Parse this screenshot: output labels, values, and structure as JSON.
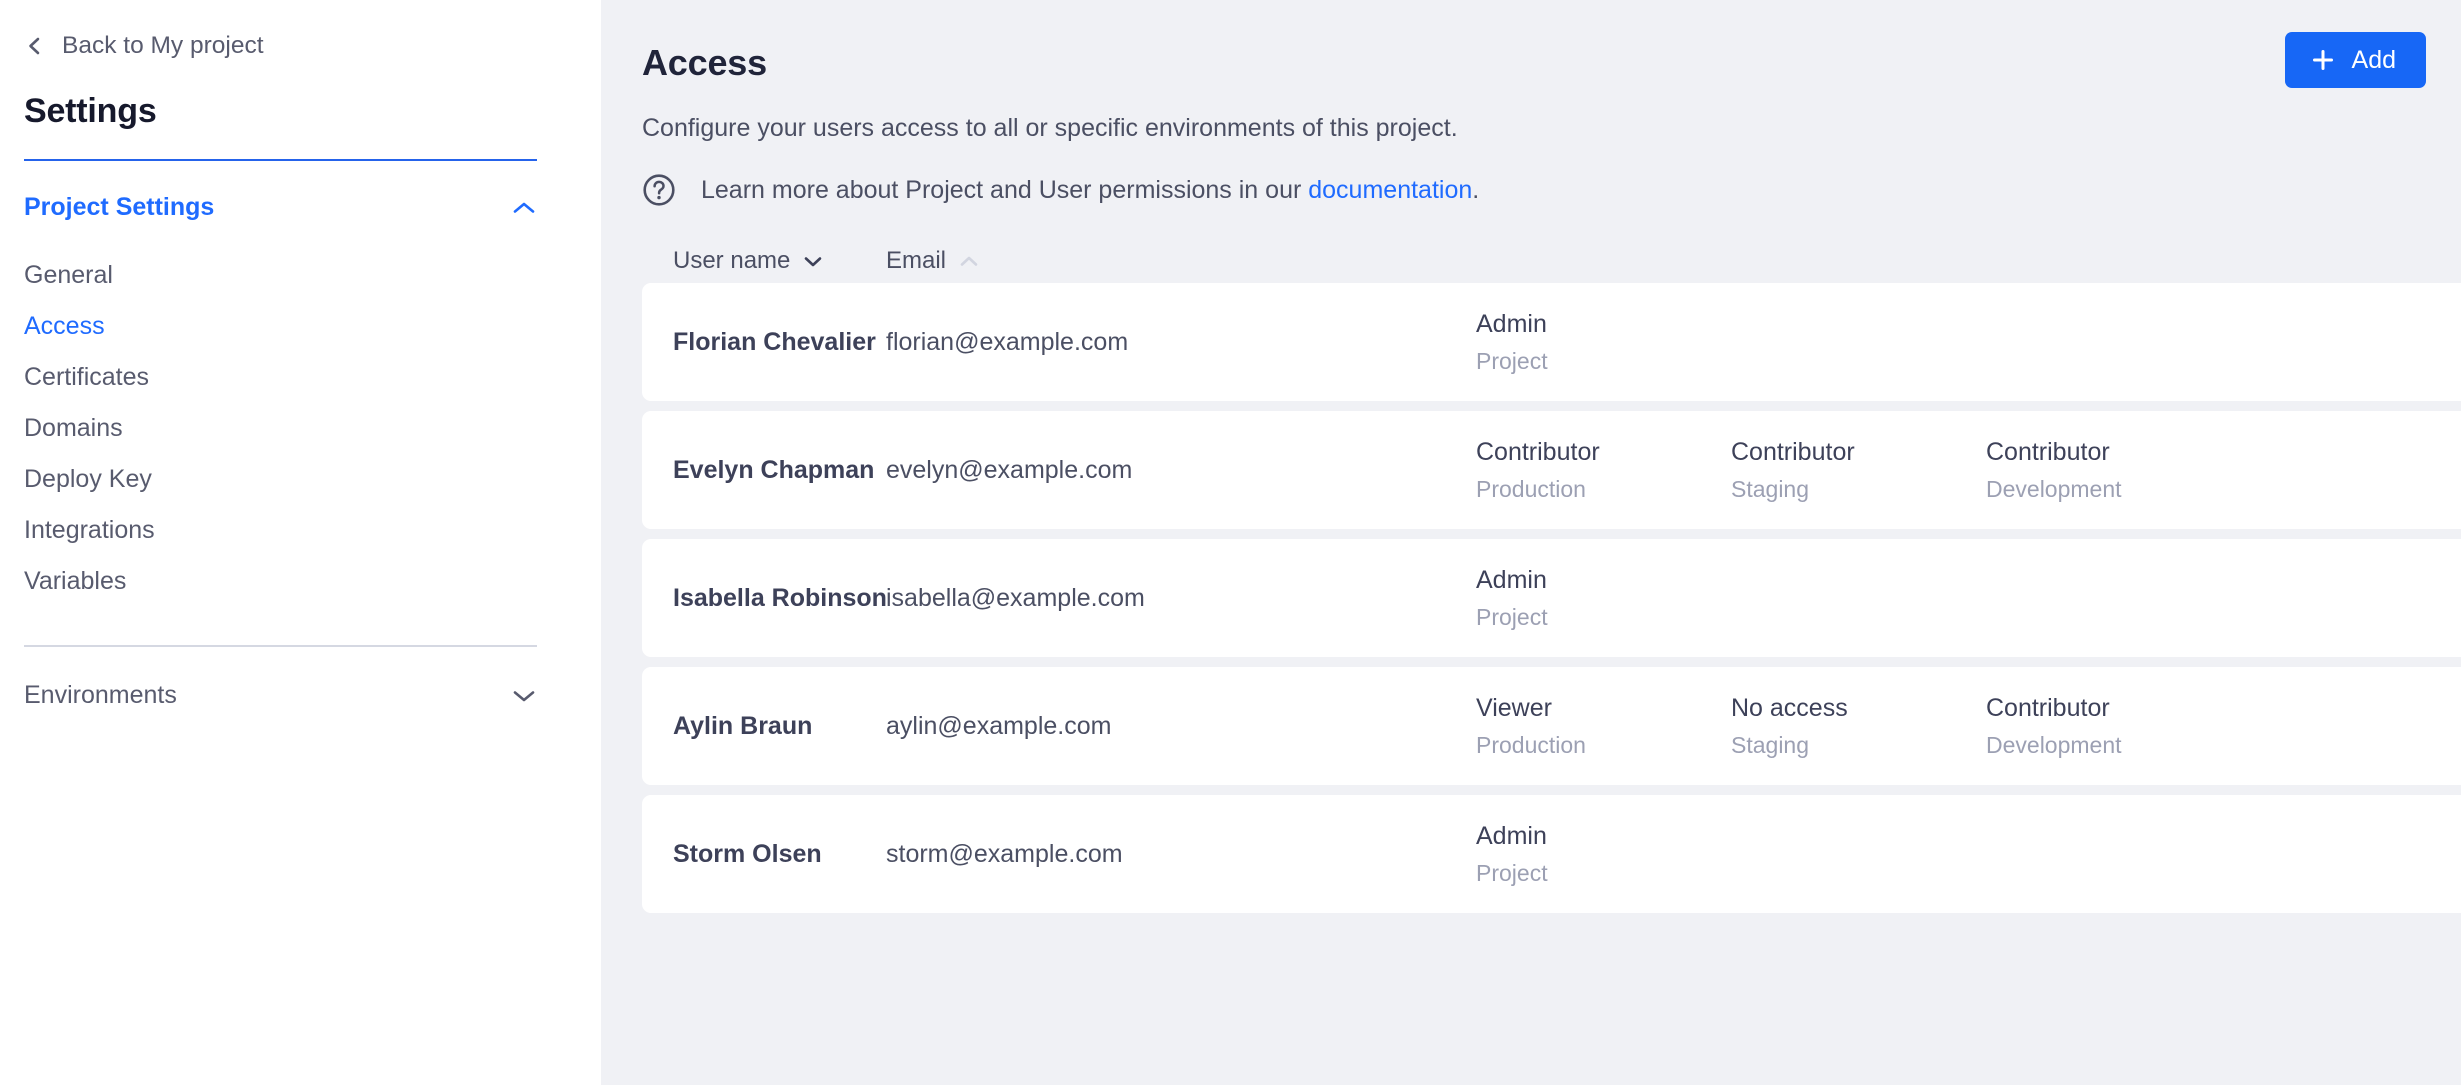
{
  "sidebar": {
    "back_label": "Back to My project",
    "title": "Settings",
    "project_settings": {
      "label": "Project Settings",
      "expanded": true,
      "items": [
        {
          "label": "General",
          "active": false
        },
        {
          "label": "Access",
          "active": true
        },
        {
          "label": "Certificates",
          "active": false
        },
        {
          "label": "Domains",
          "active": false
        },
        {
          "label": "Deploy Key",
          "active": false
        },
        {
          "label": "Integrations",
          "active": false
        },
        {
          "label": "Variables",
          "active": false
        }
      ]
    },
    "environments": {
      "label": "Environments",
      "expanded": false
    }
  },
  "main": {
    "page_title": "Access",
    "add_button_label": "Add",
    "subtitle": "Configure your users access to all or specific environments of this project.",
    "doc_text_before": "Learn more about Project and User permissions in our ",
    "doc_link_label": "documentation",
    "doc_text_after": "."
  },
  "table": {
    "columns": [
      {
        "label": "User name",
        "sort": "desc"
      },
      {
        "label": "Email",
        "sort": "asc"
      }
    ],
    "rows": [
      {
        "name": "Florian Chevalier",
        "email": "florian@example.com",
        "permissions": [
          {
            "role": "Admin",
            "scope": "Project"
          }
        ]
      },
      {
        "name": "Evelyn Chapman",
        "email": "evelyn@example.com",
        "permissions": [
          {
            "role": "Contributor",
            "scope": "Production"
          },
          {
            "role": "Contributor",
            "scope": "Staging"
          },
          {
            "role": "Contributor",
            "scope": "Development"
          }
        ]
      },
      {
        "name": "Isabella Robinson",
        "email": "isabella@example.com",
        "permissions": [
          {
            "role": "Admin",
            "scope": "Project"
          }
        ]
      },
      {
        "name": "Aylin Braun",
        "email": "aylin@example.com",
        "permissions": [
          {
            "role": "Viewer",
            "scope": "Production"
          },
          {
            "role": "No access",
            "scope": "Staging"
          },
          {
            "role": "Contributor",
            "scope": "Development"
          }
        ]
      },
      {
        "name": "Storm Olsen",
        "email": "storm@example.com",
        "permissions": [
          {
            "role": "Admin",
            "scope": "Project"
          }
        ]
      }
    ]
  },
  "colors": {
    "accent_blue": "#1f6bff",
    "button_blue": "#1767f6",
    "page_bg": "#f0f1f5",
    "card_bg": "#ffffff",
    "text_dark": "#3d4159",
    "text_muted": "#9ca0b3",
    "rule_gray": "#d5d8e2"
  }
}
